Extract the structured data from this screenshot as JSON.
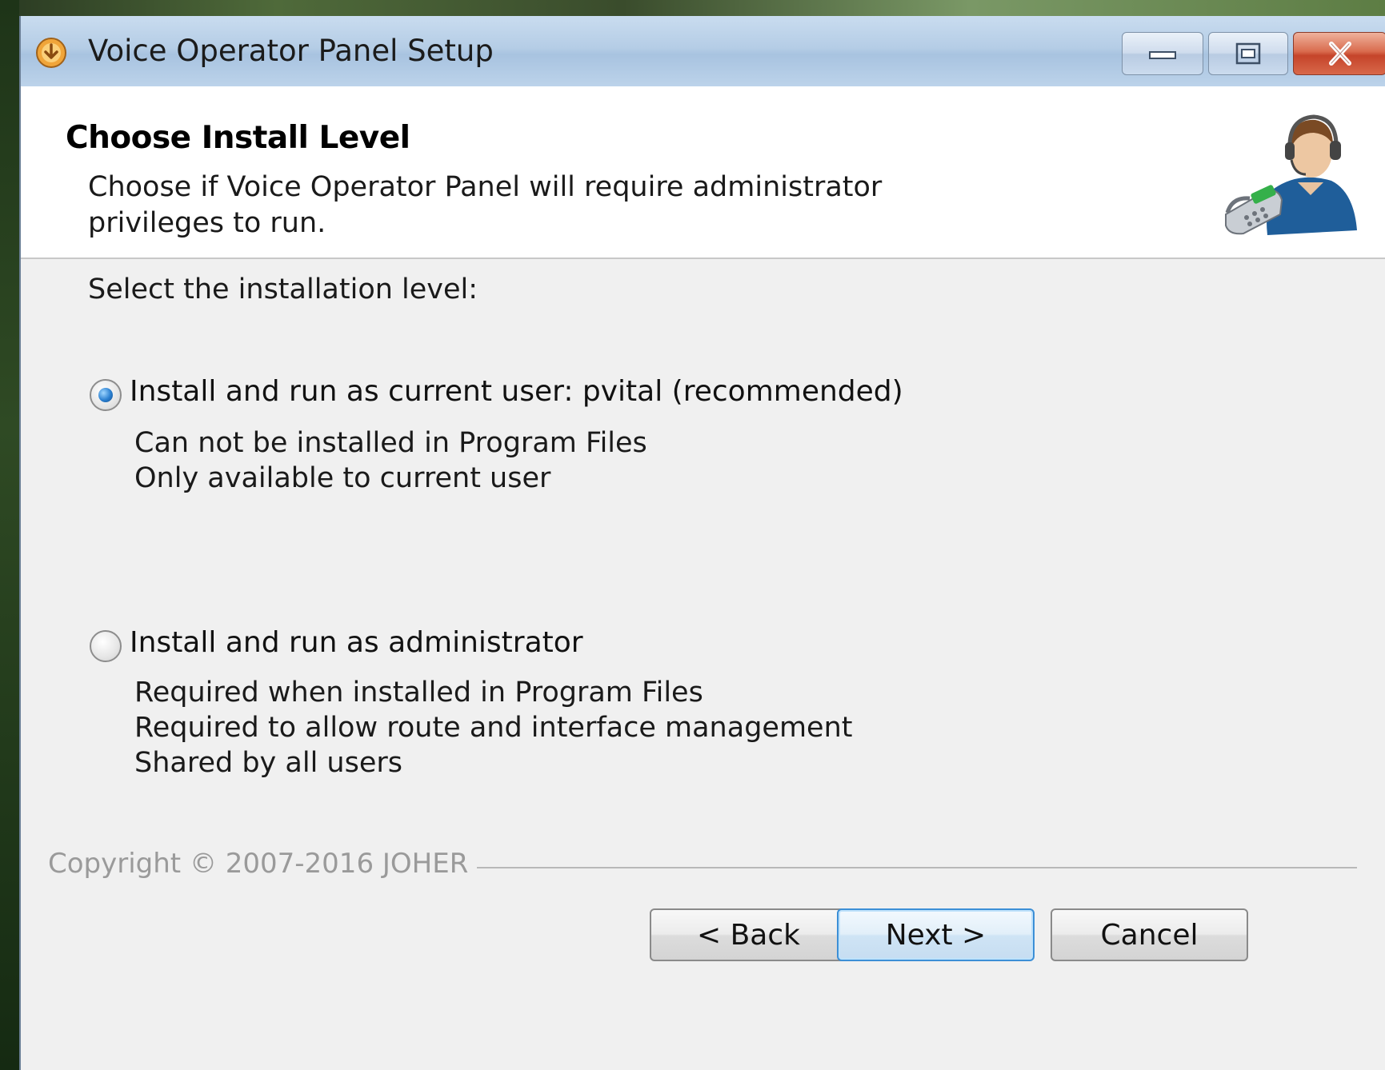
{
  "window": {
    "title": "Voice Operator Panel Setup"
  },
  "header": {
    "title": "Choose Install Level",
    "subtitle": "Choose if Voice Operator Panel will require administrator privileges to run."
  },
  "main": {
    "prompt": "Select the installation level:",
    "options": [
      {
        "label": "Install and run as current user: pvital (recommended)",
        "selected": true,
        "details": [
          "Can not be installed in Program Files",
          "Only available to current user"
        ]
      },
      {
        "label": "Install and run as administrator",
        "selected": false,
        "details": [
          "Required when installed in Program Files",
          "Required to allow route and interface management",
          "Shared by all users"
        ]
      }
    ]
  },
  "footer": {
    "copyright": "Copyright © 2007-2016 JOHER",
    "back_label": "< Back",
    "next_label": "Next >",
    "cancel_label": "Cancel"
  },
  "icons": {
    "app": "installer-icon",
    "minimize": "minimize-icon",
    "maximize": "maximize-icon",
    "close": "close-icon",
    "header": "operator-headset-icon"
  }
}
